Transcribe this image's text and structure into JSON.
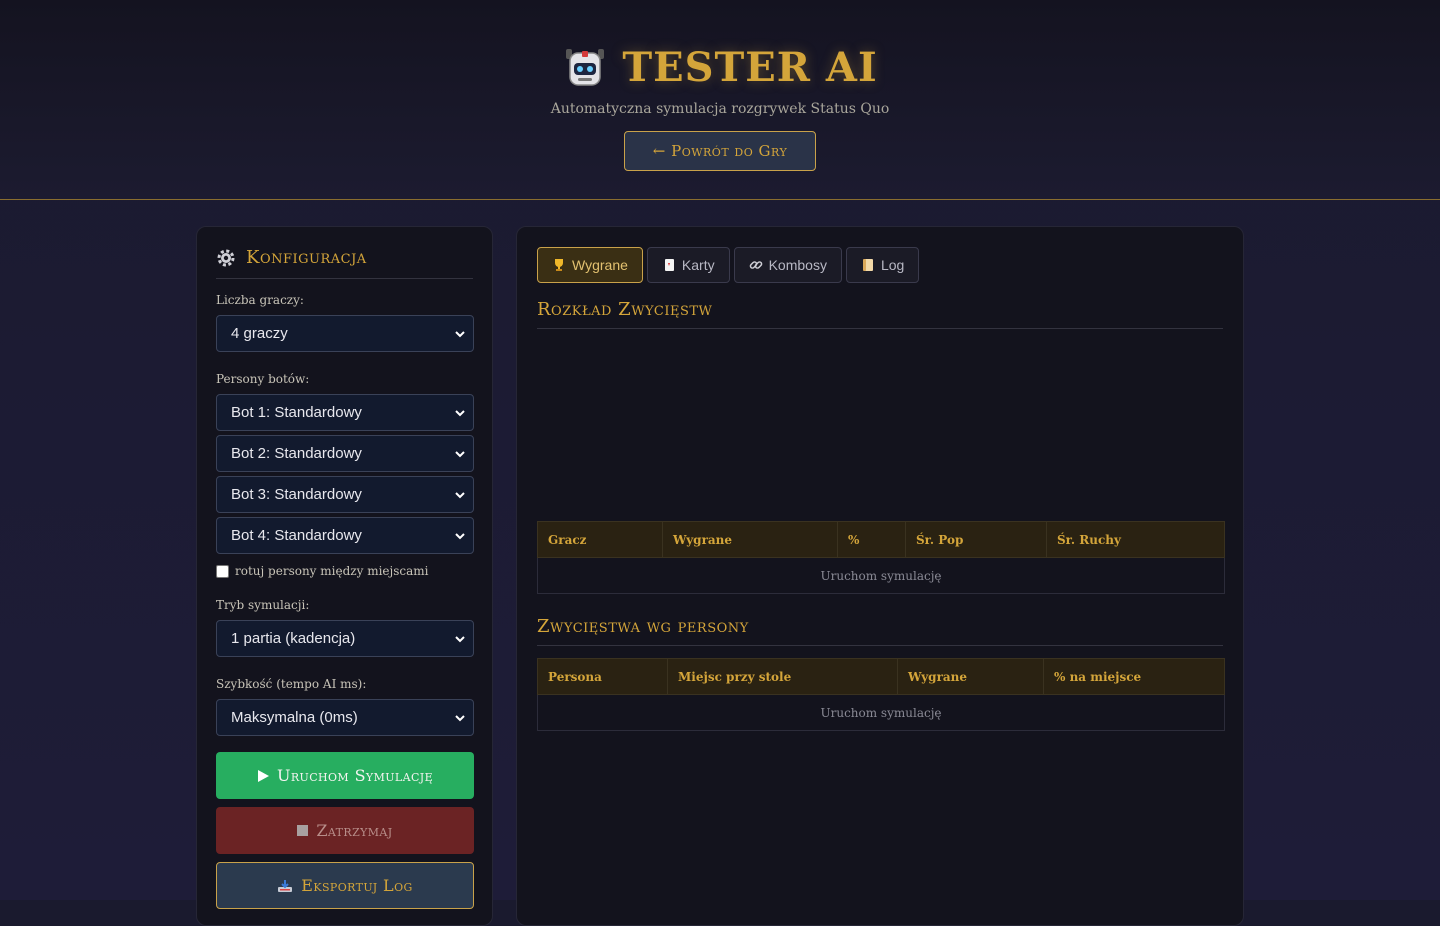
{
  "header": {
    "title": "TESTER AI",
    "subtitle": "Automatyczna symulacja rozgrywek Status Quo",
    "back_label": "← Powrót do Gry",
    "logo_icon": "robot-icon"
  },
  "config": {
    "title": "Konfiguracja",
    "players_label": "Liczba graczy:",
    "players_value": "4 graczy",
    "personas_label": "Persony botów:",
    "bots": [
      "Bot 1: Standardowy",
      "Bot 2: Standardowy",
      "Bot 3: Standardowy",
      "Bot 4: Standardowy"
    ],
    "rotate_label": "rotuj persony między miejscami",
    "mode_label": "Tryb symulacji:",
    "mode_value": "1 partia (kadencja)",
    "speed_label": "Szybkość (tempo AI ms):",
    "speed_value": "Maksymalna (0ms)",
    "run_label": "Uruchom Symulację",
    "stop_label": "Zatrzymaj",
    "export_label": "Eksportuj Log"
  },
  "tabs": [
    {
      "label": "Wygrane",
      "icon": "trophy-icon"
    },
    {
      "label": "Karty",
      "icon": "card-icon"
    },
    {
      "label": "Kombosy",
      "icon": "link-icon"
    },
    {
      "label": "Log",
      "icon": "scroll-icon"
    }
  ],
  "wins": {
    "title": "Rozkład Zwycięstw",
    "columns": [
      "Gracz",
      "Wygrane",
      "%",
      "Śr. Pop",
      "Śr. Ruchy"
    ],
    "empty": "Uruchom symulację"
  },
  "persona": {
    "title": "Zwycięstwa wg persony",
    "columns": [
      "Persona",
      "Miejsc przy stole",
      "Wygrane",
      "% na miejsce"
    ],
    "empty": "Uruchom symulację"
  },
  "colors": {
    "accent": "#d4a53a",
    "run": "#27ae60",
    "stop": "#6b2324"
  }
}
